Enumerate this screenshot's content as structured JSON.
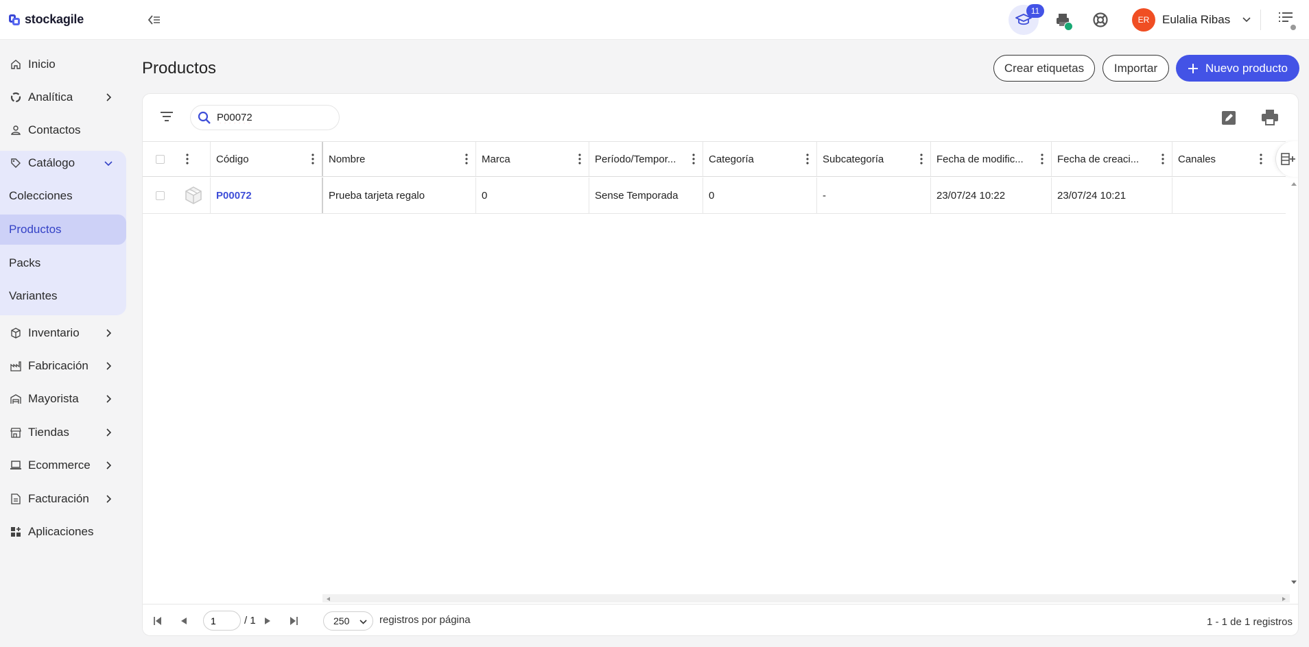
{
  "app": {
    "name": "stockagile"
  },
  "user": {
    "initials": "ER",
    "name": "Eulalia Ribas"
  },
  "header": {
    "academy_badge": "11"
  },
  "sidebar": {
    "items": [
      {
        "label": "Inicio",
        "icon": "home-icon"
      },
      {
        "label": "Analítica",
        "icon": "analytics-icon"
      },
      {
        "label": "Contactos",
        "icon": "person-icon"
      },
      {
        "label": "Catálogo",
        "icon": "tag-icon"
      },
      {
        "label": "Inventario",
        "icon": "box-icon"
      },
      {
        "label": "Fabricación",
        "icon": "factory-icon"
      },
      {
        "label": "Mayorista",
        "icon": "warehouse-icon"
      },
      {
        "label": "Tiendas",
        "icon": "store-icon"
      },
      {
        "label": "Ecommerce",
        "icon": "laptop-icon"
      },
      {
        "label": "Facturación",
        "icon": "invoice-icon"
      },
      {
        "label": "Aplicaciones",
        "icon": "apps-icon"
      }
    ],
    "catalog_sub": [
      "Colecciones",
      "Productos",
      "Packs",
      "Variantes"
    ]
  },
  "page": {
    "title": "Productos",
    "buttons": {
      "labels": "Crear etiquetas",
      "import": "Importar",
      "new": "Nuevo producto"
    }
  },
  "search": {
    "value": "P00072"
  },
  "table": {
    "columns": [
      "Código",
      "Nombre",
      "Marca",
      "Período/Tempor...",
      "Categoría",
      "Subcategoría",
      "Fecha de modific...",
      "Fecha de creaci...",
      "Canales"
    ],
    "rows": [
      {
        "code": "P00072",
        "name": "Prueba tarjeta regalo",
        "brand": "0",
        "period": "Sense Temporada",
        "category": "0",
        "subcategory": "-",
        "modified": "23/07/24 10:22",
        "created": "23/07/24 10:21",
        "channels": ""
      }
    ]
  },
  "pagination": {
    "page": "1",
    "of": "/ 1",
    "page_size": "250",
    "page_size_label": "registros por página",
    "count": "1 - 1 de 1 registros"
  },
  "colors": {
    "accent": "#4353e6",
    "link": "#3e4ed8",
    "avatar": "#f04e23",
    "active_bg": "#cdd1f7"
  }
}
